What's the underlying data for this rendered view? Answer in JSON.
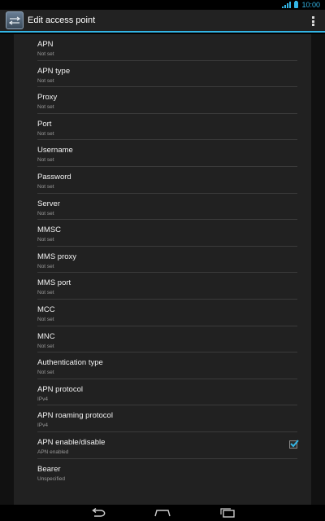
{
  "status_bar": {
    "time": "10:00",
    "icons": [
      "signal-icon",
      "battery-icon"
    ]
  },
  "action_bar": {
    "title": "Edit access point",
    "icons": [
      "apn-settings-icon",
      "overflow-menu-icon"
    ]
  },
  "preferences": [
    {
      "title": "APN",
      "summary": "Not set"
    },
    {
      "title": "APN type",
      "summary": "Not set"
    },
    {
      "title": "Proxy",
      "summary": "Not set"
    },
    {
      "title": "Port",
      "summary": "Not set"
    },
    {
      "title": "Username",
      "summary": "Not set"
    },
    {
      "title": "Password",
      "summary": "Not set"
    },
    {
      "title": "Server",
      "summary": "Not set"
    },
    {
      "title": "MMSC",
      "summary": "Not set"
    },
    {
      "title": "MMS proxy",
      "summary": "Not set"
    },
    {
      "title": "MMS port",
      "summary": "Not set"
    },
    {
      "title": "MCC",
      "summary": "Not set"
    },
    {
      "title": "MNC",
      "summary": "Not set"
    },
    {
      "title": "Authentication type",
      "summary": "Not set"
    },
    {
      "title": "APN protocol",
      "summary": "IPv4"
    },
    {
      "title": "APN roaming protocol",
      "summary": "IPv4"
    },
    {
      "title": "APN enable/disable",
      "summary": "APN enabled",
      "checked": true
    },
    {
      "title": "Bearer",
      "summary": "Unspecified"
    }
  ],
  "nav_bar": {
    "icons": [
      "back-icon",
      "home-icon",
      "recent-apps-icon"
    ]
  },
  "colors": {
    "accent": "#33b5e5",
    "background": "#212121",
    "divider": "#3b3b3b"
  }
}
